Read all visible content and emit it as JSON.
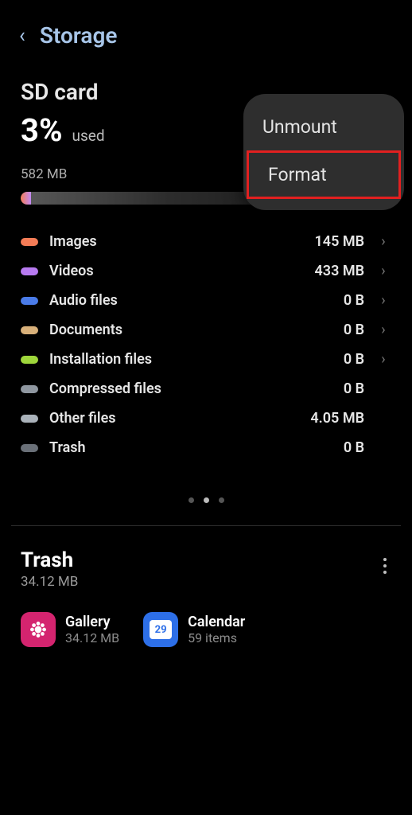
{
  "header": {
    "title": "Storage"
  },
  "storage": {
    "title": "SD card",
    "percent": "3%",
    "percent_label": "used",
    "total": "582 MB"
  },
  "categories": [
    {
      "name": "Images",
      "size": "145 MB",
      "color": "#f47c56",
      "chevron": true
    },
    {
      "name": "Videos",
      "size": "433 MB",
      "color": "#b77af0",
      "chevron": true
    },
    {
      "name": "Audio files",
      "size": "0 B",
      "color": "#4a7be8",
      "chevron": true
    },
    {
      "name": "Documents",
      "size": "0 B",
      "color": "#d8b07a",
      "chevron": true
    },
    {
      "name": "Installation files",
      "size": "0 B",
      "color": "#9ed63b",
      "chevron": true
    },
    {
      "name": "Compressed files",
      "size": "0 B",
      "color": "#8f97a0",
      "chevron": false
    },
    {
      "name": "Other files",
      "size": "4.05 MB",
      "color": "#aab2ba",
      "chevron": false
    },
    {
      "name": "Trash",
      "size": "0 B",
      "color": "#6a7078",
      "chevron": false
    }
  ],
  "trash": {
    "title": "Trash",
    "subtitle": "34.12 MB",
    "apps": [
      {
        "name": "Gallery",
        "sub": "34.12 MB",
        "icon": "gallery"
      },
      {
        "name": "Calendar",
        "sub": "59 items",
        "icon": "calendar",
        "badge": "29"
      }
    ]
  },
  "menu": {
    "items": [
      "Unmount",
      "Format"
    ]
  }
}
